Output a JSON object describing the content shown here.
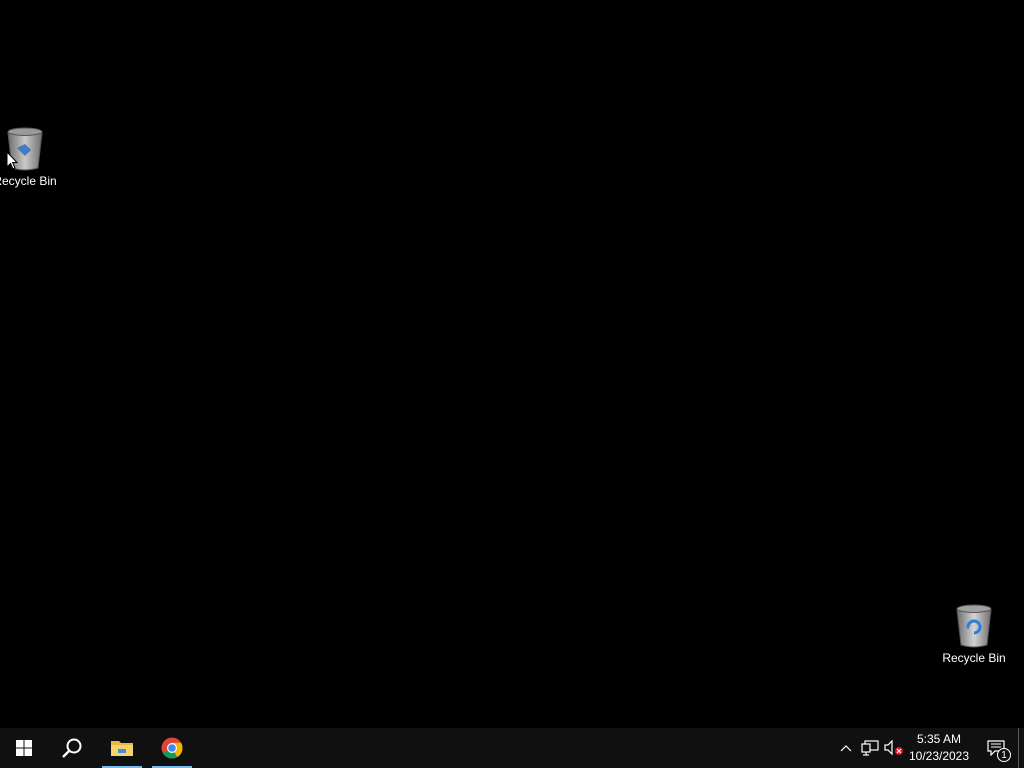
{
  "desktop": {
    "background_color": "#000000",
    "icons": [
      {
        "label": "Recycle Bin",
        "icon": "recycle-bin-icon"
      },
      {
        "label": "Recycle Bin",
        "icon": "recycle-bin-icon"
      }
    ]
  },
  "taskbar": {
    "background_color": "#101010",
    "accent_color": "#76b9ed",
    "buttons": [
      {
        "name": "start",
        "icon": "windows-logo-icon"
      },
      {
        "name": "search",
        "icon": "search-icon"
      },
      {
        "name": "file-explorer",
        "icon": "folder-icon",
        "running": true
      },
      {
        "name": "chrome",
        "icon": "chrome-icon",
        "running": true
      }
    ],
    "tray": {
      "icons": [
        "chevron-up-icon",
        "network-icon",
        "volume-muted-icon"
      ],
      "time": "5:35 AM",
      "date": "10/23/2023",
      "notification_count": "1"
    }
  }
}
